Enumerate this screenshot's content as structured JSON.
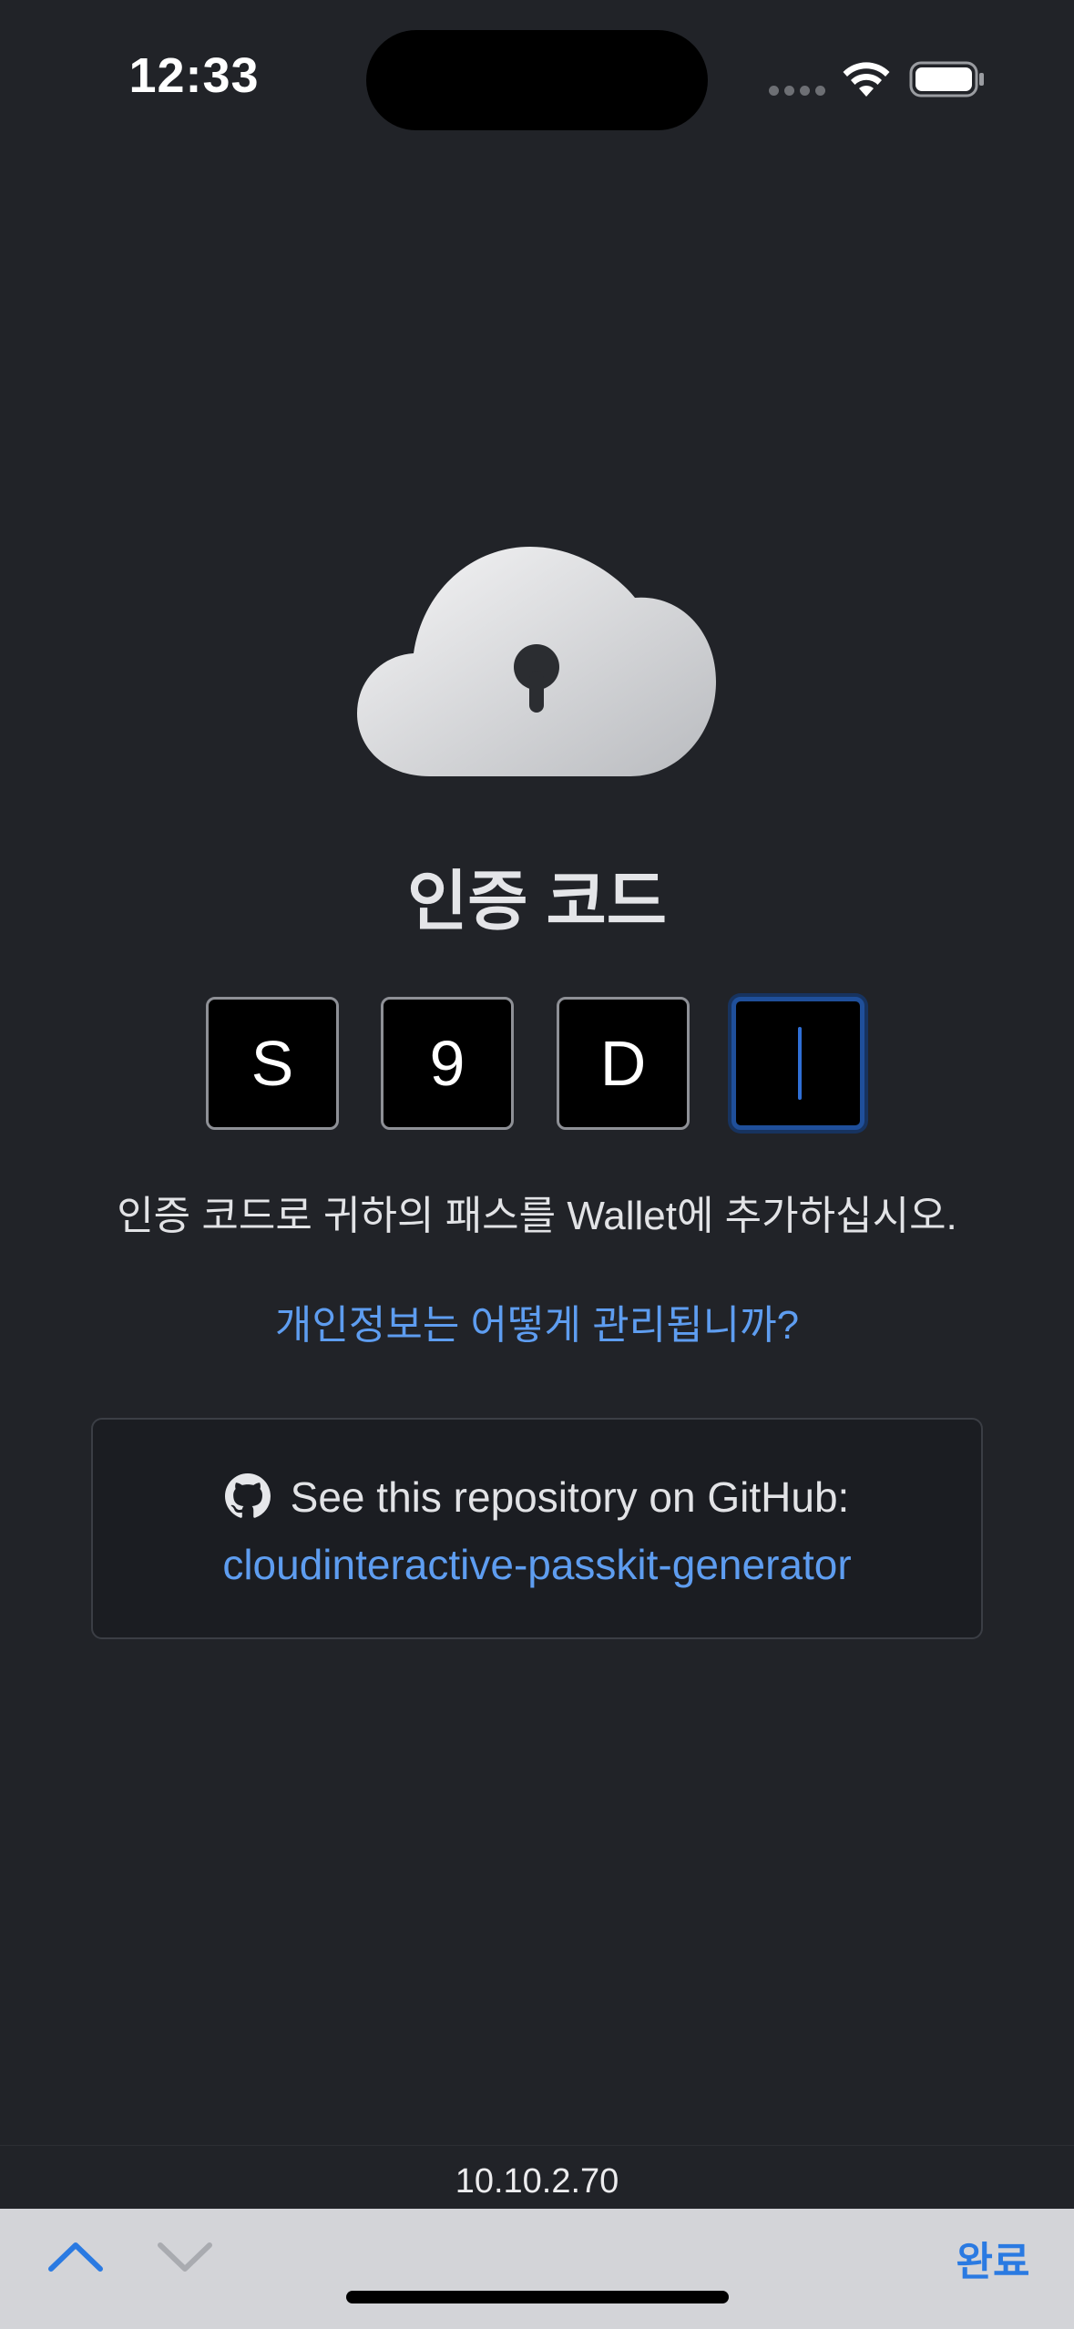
{
  "status_bar": {
    "time": "12:33",
    "wifi_icon": "wifi-icon",
    "battery_icon": "battery-icon"
  },
  "main": {
    "icon": "cloud-lock-icon",
    "title": "인증 코드",
    "code_boxes": [
      {
        "value": "S"
      },
      {
        "value": "9"
      },
      {
        "value": "D"
      },
      {
        "value": ""
      }
    ],
    "instruction": "인증 코드로 귀하의 패스를 Wallet에 추가하십시오.",
    "privacy_link": "개인정보는 어떻게 관리됩니까?"
  },
  "github_card": {
    "icon": "github-icon",
    "label": "See this repository on GitHub:",
    "repo_link": "cloudinteractive-passkit-generator"
  },
  "address_bar": {
    "host": "10.10.2.70"
  },
  "keyboard_toolbar": {
    "done_label": "완료"
  },
  "colors": {
    "background": "#212328",
    "link": "#5e9df0",
    "active_border": "#1f4f9a",
    "done": "#2a7ae2"
  }
}
